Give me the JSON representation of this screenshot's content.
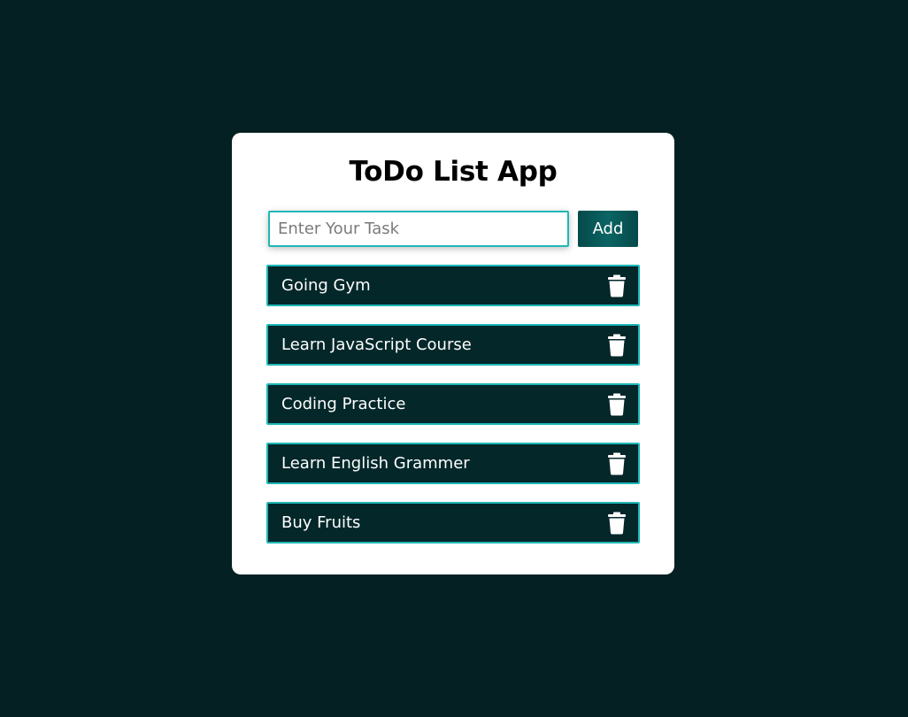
{
  "app": {
    "title": "ToDo List App"
  },
  "form": {
    "input_value": "",
    "input_placeholder": "Enter Your Task",
    "add_label": "Add"
  },
  "tasks": [
    {
      "text": "Going Gym",
      "icon": "trash-icon"
    },
    {
      "text": "Learn JavaScript Course",
      "icon": "trash-icon"
    },
    {
      "text": "Coding Practice",
      "icon": "trash-icon"
    },
    {
      "text": "Learn English Grammer",
      "icon": "trash-icon"
    },
    {
      "text": "Buy Fruits",
      "icon": "trash-icon"
    }
  ],
  "colors": {
    "background": "#042022",
    "card": "#ffffff",
    "accent_border": "#1fb7b7",
    "task_bg": "#04272a",
    "button_bg": "#0b6464"
  }
}
